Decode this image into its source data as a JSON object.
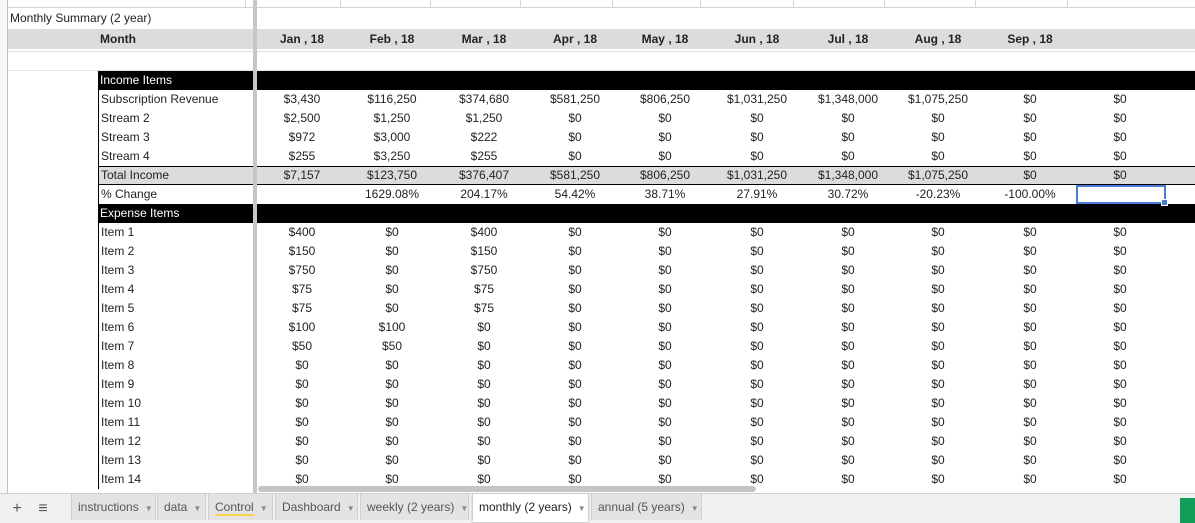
{
  "title": "Monthly Summary (2 year)",
  "month_label": "Month",
  "months": [
    "Jan , 18",
    "Feb , 18",
    "Mar , 18",
    "Apr , 18",
    "May , 18",
    "Jun , 18",
    "Jul , 18",
    "Aug , 18",
    "Sep , 18",
    ""
  ],
  "income_header": "Income Items",
  "income_rows": [
    {
      "label": "Subscription Revenue",
      "values": [
        "$3,430",
        "$116,250",
        "$374,680",
        "$581,250",
        "$806,250",
        "$1,031,250",
        "$1,348,000",
        "$1,075,250",
        "$0",
        "$0"
      ]
    },
    {
      "label": "Stream 2",
      "values": [
        "$2,500",
        "$1,250",
        "$1,250",
        "$0",
        "$0",
        "$0",
        "$0",
        "$0",
        "$0",
        "$0"
      ]
    },
    {
      "label": "Stream 3",
      "values": [
        "$972",
        "$3,000",
        "$222",
        "$0",
        "$0",
        "$0",
        "$0",
        "$0",
        "$0",
        "$0"
      ]
    },
    {
      "label": "Stream 4",
      "values": [
        "$255",
        "$3,250",
        "$255",
        "$0",
        "$0",
        "$0",
        "$0",
        "$0",
        "$0",
        "$0"
      ]
    }
  ],
  "total_income": {
    "label": "Total Income",
    "values": [
      "$7,157",
      "$123,750",
      "$376,407",
      "$581,250",
      "$806,250",
      "$1,031,250",
      "$1,348,000",
      "$1,075,250",
      "$0",
      "$0"
    ]
  },
  "pct_change": {
    "label": "% Change",
    "values": [
      "",
      "1629.08%",
      "204.17%",
      "54.42%",
      "38.71%",
      "27.91%",
      "30.72%",
      "-20.23%",
      "-100.00%",
      ""
    ]
  },
  "expense_header": "Expense Items",
  "expense_rows": [
    {
      "label": "Item 1",
      "values": [
        "$400",
        "$0",
        "$400",
        "$0",
        "$0",
        "$0",
        "$0",
        "$0",
        "$0",
        "$0"
      ]
    },
    {
      "label": "Item 2",
      "values": [
        "$150",
        "$0",
        "$150",
        "$0",
        "$0",
        "$0",
        "$0",
        "$0",
        "$0",
        "$0"
      ]
    },
    {
      "label": "Item 3",
      "values": [
        "$750",
        "$0",
        "$750",
        "$0",
        "$0",
        "$0",
        "$0",
        "$0",
        "$0",
        "$0"
      ]
    },
    {
      "label": "Item 4",
      "values": [
        "$75",
        "$0",
        "$75",
        "$0",
        "$0",
        "$0",
        "$0",
        "$0",
        "$0",
        "$0"
      ]
    },
    {
      "label": "Item 5",
      "values": [
        "$75",
        "$0",
        "$75",
        "$0",
        "$0",
        "$0",
        "$0",
        "$0",
        "$0",
        "$0"
      ]
    },
    {
      "label": "Item 6",
      "values": [
        "$100",
        "$100",
        "$0",
        "$0",
        "$0",
        "$0",
        "$0",
        "$0",
        "$0",
        "$0"
      ]
    },
    {
      "label": "Item 7",
      "values": [
        "$50",
        "$50",
        "$0",
        "$0",
        "$0",
        "$0",
        "$0",
        "$0",
        "$0",
        "$0"
      ]
    },
    {
      "label": "Item 8",
      "values": [
        "$0",
        "$0",
        "$0",
        "$0",
        "$0",
        "$0",
        "$0",
        "$0",
        "$0",
        "$0"
      ]
    },
    {
      "label": "Item 9",
      "values": [
        "$0",
        "$0",
        "$0",
        "$0",
        "$0",
        "$0",
        "$0",
        "$0",
        "$0",
        "$0"
      ]
    },
    {
      "label": "Item 10",
      "values": [
        "$0",
        "$0",
        "$0",
        "$0",
        "$0",
        "$0",
        "$0",
        "$0",
        "$0",
        "$0"
      ]
    },
    {
      "label": "Item 11",
      "values": [
        "$0",
        "$0",
        "$0",
        "$0",
        "$0",
        "$0",
        "$0",
        "$0",
        "$0",
        "$0"
      ]
    },
    {
      "label": "Item 12",
      "values": [
        "$0",
        "$0",
        "$0",
        "$0",
        "$0",
        "$0",
        "$0",
        "$0",
        "$0",
        "$0"
      ]
    },
    {
      "label": "Item 13",
      "values": [
        "$0",
        "$0",
        "$0",
        "$0",
        "$0",
        "$0",
        "$0",
        "$0",
        "$0",
        "$0"
      ]
    },
    {
      "label": "Item 14",
      "values": [
        "$0",
        "$0",
        "$0",
        "$0",
        "$0",
        "$0",
        "$0",
        "$0",
        "$0",
        "$0"
      ]
    }
  ],
  "tabbar": {
    "add_icon": "+",
    "menu_icon": "≡",
    "tabs": [
      {
        "label": "instructions",
        "active": false
      },
      {
        "label": "data",
        "active": false
      },
      {
        "label": "Control",
        "active": false
      },
      {
        "label": "Dashboard",
        "active": false
      },
      {
        "label": "weekly (2 years)",
        "active": false
      },
      {
        "label": "monthly (2 years)",
        "active": true
      },
      {
        "label": "annual (5 years)",
        "active": false
      }
    ]
  },
  "colors": {
    "section_bar": "#000000",
    "header_gray": "#dcdcdc",
    "selection": "#4a7bd5",
    "tab_active_bg": "#ffffff"
  }
}
